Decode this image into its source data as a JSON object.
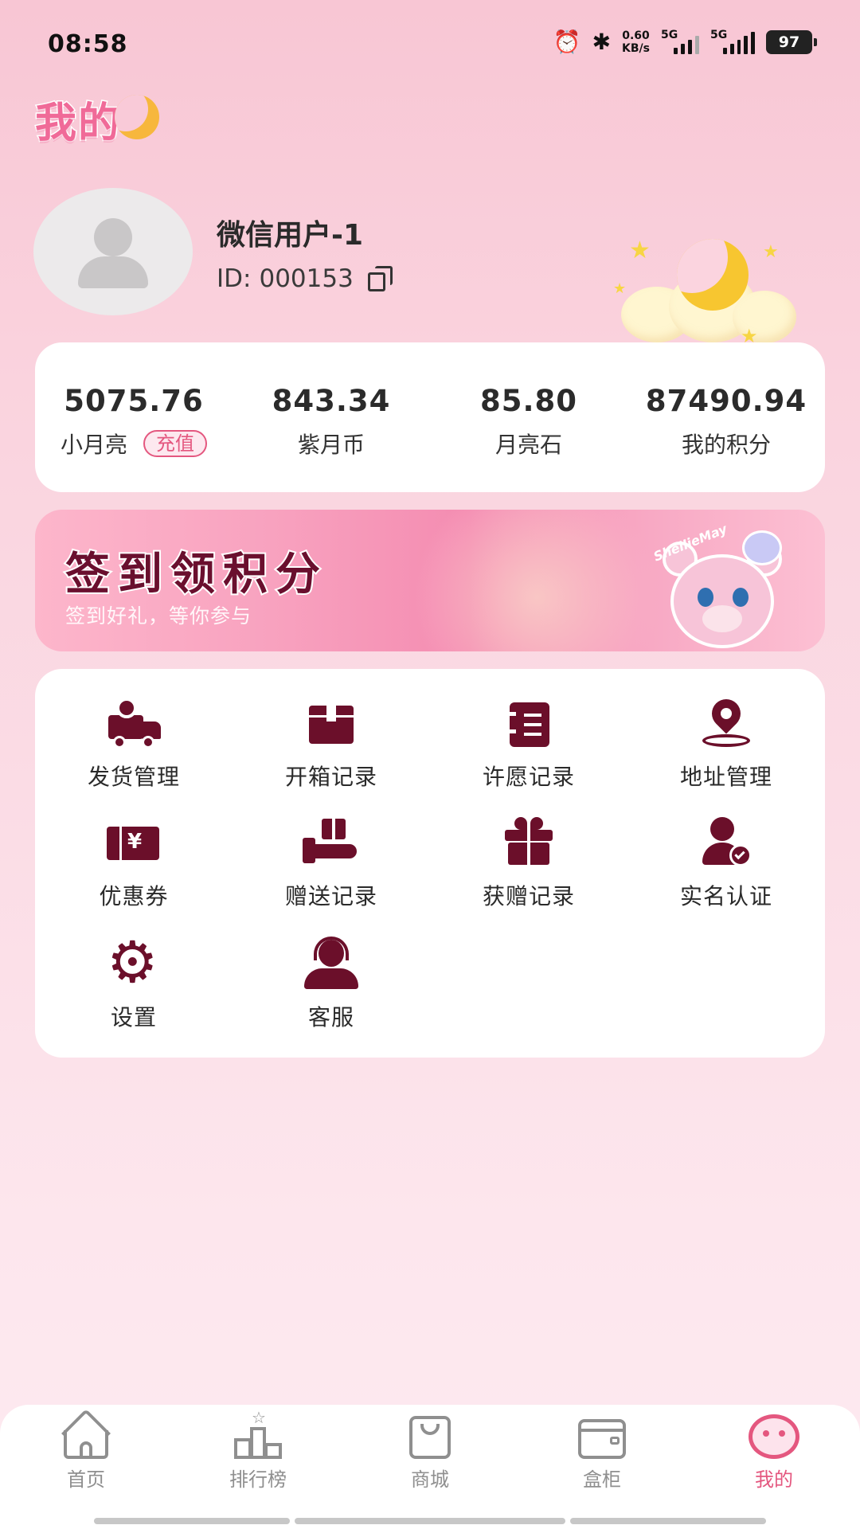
{
  "status_bar": {
    "time": "08:58",
    "net_speed_value": "0.60",
    "net_speed_unit": "KB/s",
    "sim1_label": "5G",
    "sim2_label": "5G",
    "battery": "97"
  },
  "page": {
    "title": "我的"
  },
  "profile": {
    "username": "微信用户-1",
    "id_label": "ID:",
    "id_value": "000153"
  },
  "stats": [
    {
      "value": "5075.76",
      "label": "小月亮",
      "badge": "充值"
    },
    {
      "value": "843.34",
      "label": "紫月币"
    },
    {
      "value": "85.80",
      "label": "月亮石"
    },
    {
      "value": "87490.94",
      "label": "我的积分"
    }
  ],
  "banner": {
    "title": "签到领积分",
    "subtitle": "签到好礼，等你参与",
    "character_tag": "ShellieMay"
  },
  "menu": [
    {
      "label": "发货管理",
      "icon": "delivery-truck-icon"
    },
    {
      "label": "开箱记录",
      "icon": "box-icon"
    },
    {
      "label": "许愿记录",
      "icon": "notebook-icon"
    },
    {
      "label": "地址管理",
      "icon": "location-pin-icon"
    },
    {
      "label": "优惠券",
      "icon": "coupon-icon"
    },
    {
      "label": "赠送记录",
      "icon": "gift-hand-icon"
    },
    {
      "label": "获赠记录",
      "icon": "gift-box-icon"
    },
    {
      "label": "实名认证",
      "icon": "user-verified-icon"
    },
    {
      "label": "设置",
      "icon": "gear-icon"
    },
    {
      "label": "客服",
      "icon": "customer-service-icon"
    }
  ],
  "tabbar": [
    {
      "label": "首页",
      "icon": "home-icon",
      "active": false
    },
    {
      "label": "排行榜",
      "icon": "podium-icon",
      "active": false
    },
    {
      "label": "商城",
      "icon": "shopping-bag-icon",
      "active": false
    },
    {
      "label": "盒柜",
      "icon": "cabinet-icon",
      "active": false
    },
    {
      "label": "我的",
      "icon": "profile-face-icon",
      "active": true
    }
  ],
  "colors": {
    "accent": "#e4577f",
    "icon_dark": "#6b0f2a",
    "title_pink": "#f06a98",
    "inactive_tab": "#8f8f8f"
  }
}
